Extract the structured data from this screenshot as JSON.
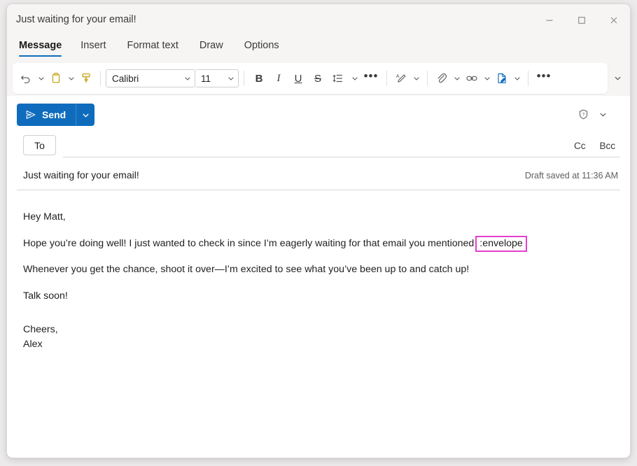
{
  "window": {
    "title": "Just waiting for your email!",
    "controls": {
      "minimize": "minimize-button",
      "maximize": "maximize-button",
      "close": "close-button"
    }
  },
  "ribbon": {
    "tabs": [
      {
        "label": "Message",
        "active": true
      },
      {
        "label": "Insert",
        "active": false
      },
      {
        "label": "Format text",
        "active": false
      },
      {
        "label": "Draw",
        "active": false
      },
      {
        "label": "Options",
        "active": false
      }
    ],
    "toolbar": {
      "undo": "undo-icon",
      "paste": "paste-icon",
      "format_painter": "format-painter-icon",
      "font_name": "Calibri",
      "font_size": "11",
      "bold": "B",
      "italic": "I",
      "underline": "U",
      "strikethrough": "S",
      "line_spacing": "line-spacing-icon",
      "more_format": "•••",
      "text_highlight": "text-highlight-icon",
      "attach": "attach-icon",
      "link": "link-icon",
      "signature": "signature-icon",
      "more_commands": "•••",
      "expand_ribbon": "chevron-down-icon"
    }
  },
  "compose": {
    "send_label": "Send",
    "send_dropdown": "chevron-down-icon",
    "help_icon": "sensitivity-shield-icon",
    "help_dropdown": "chevron-down-icon",
    "to_label": "To",
    "to_value": "",
    "cc_label": "Cc",
    "bcc_label": "Bcc",
    "subject": "Just waiting for your email!",
    "draft_status": "Draft saved at 11:36 AM",
    "body": {
      "greeting": "Hey Matt,",
      "line2_before": "Hope you’re doing well! I just wanted to check in since I’m eagerly waiting for that email you mentioned",
      "line2_token": ":envelope",
      "line3": "Whenever you get the chance, shoot it over—I’m excited to see what you’ve been up to and catch up!",
      "line4": "Talk soon!",
      "signoff": "Cheers,",
      "signature_name": "Alex"
    }
  },
  "colors": {
    "accent": "#0f6cbd",
    "token_outline": "#e43fd0",
    "chrome_bg": "#f6f5f4",
    "gold_icon": "#c19c00"
  }
}
